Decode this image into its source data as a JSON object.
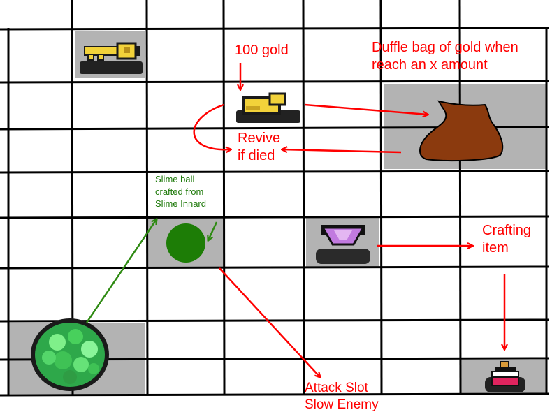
{
  "labels": {
    "hundred_gold": "100 gold",
    "duffle_line1": "Duffle bag of gold when",
    "duffle_line2": "reach an x amount",
    "revive_line1": "Revive",
    "revive_line2": "if died",
    "slime_line1": "Slime ball",
    "slime_line2": "crafted from",
    "slime_line3": "Slime Innard",
    "crafting_line1": "Crafting",
    "crafting_line2": "item",
    "attack_line1": "Attack Slot",
    "attack_line2": "Slow Enemy"
  },
  "items": {
    "key": "key-icon",
    "gold_pile": "gold-pile-icon",
    "duffle_bag": "duffle-bag-icon",
    "slime_ball": "slime-ball-icon",
    "gem": "purple-gem-icon",
    "potion": "potion-icon",
    "slime_innard": "slime-innard-icon"
  },
  "colors": {
    "annotation_red": "#ff0000",
    "annotation_green": "#2e8a12",
    "slot_gray": "#b3b3b3",
    "gold": "#e6c229",
    "bag_brown": "#8b3a0e",
    "slime_green": "#1d7d06",
    "gem_purple": "#c17adf",
    "potion_pink": "#e0245e"
  }
}
